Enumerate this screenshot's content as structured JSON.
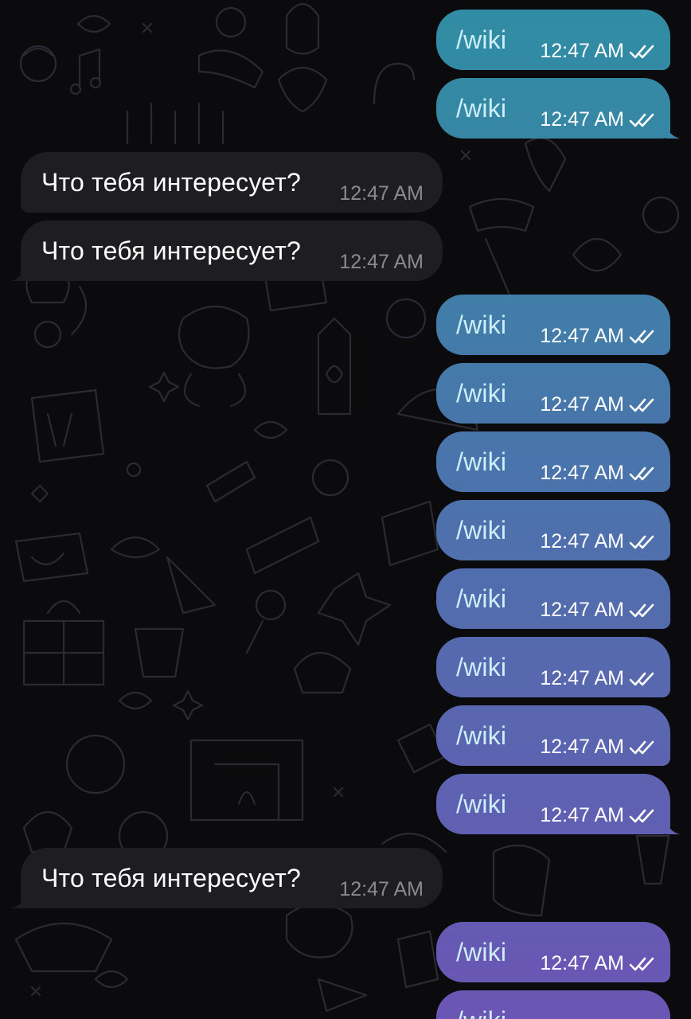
{
  "colors": {
    "background": "#0b0b0d",
    "incoming_bubble": "#1e1e22",
    "outgoing_gradient_top": "#2f8ea3",
    "outgoing_gradient_bottom": "#6b55b5",
    "outgoing_text": "#cdeffa",
    "incoming_time": "#8a8a8f"
  },
  "messages": [
    {
      "direction": "out",
      "text": "/wiki",
      "time": "12:47 AM",
      "status_icon": "double-check-icon"
    },
    {
      "direction": "out",
      "text": "/wiki",
      "time": "12:47 AM",
      "status_icon": "double-check-icon"
    },
    {
      "direction": "in",
      "text": "Что тебя интересует?",
      "time": "12:47 AM"
    },
    {
      "direction": "in",
      "text": "Что тебя интересует?",
      "time": "12:47 AM"
    },
    {
      "direction": "out",
      "text": "/wiki",
      "time": "12:47 AM",
      "status_icon": "double-check-icon"
    },
    {
      "direction": "out",
      "text": "/wiki",
      "time": "12:47 AM",
      "status_icon": "double-check-icon"
    },
    {
      "direction": "out",
      "text": "/wiki",
      "time": "12:47 AM",
      "status_icon": "double-check-icon"
    },
    {
      "direction": "out",
      "text": "/wiki",
      "time": "12:47 AM",
      "status_icon": "double-check-icon"
    },
    {
      "direction": "out",
      "text": "/wiki",
      "time": "12:47 AM",
      "status_icon": "double-check-icon"
    },
    {
      "direction": "out",
      "text": "/wiki",
      "time": "12:47 AM",
      "status_icon": "double-check-icon"
    },
    {
      "direction": "out",
      "text": "/wiki",
      "time": "12:47 AM",
      "status_icon": "double-check-icon"
    },
    {
      "direction": "out",
      "text": "/wiki",
      "time": "12:47 AM",
      "status_icon": "double-check-icon"
    },
    {
      "direction": "in",
      "text": "Что тебя интересует?",
      "time": "12:47 AM"
    },
    {
      "direction": "out",
      "text": "/wiki",
      "time": "12:47 AM",
      "status_icon": "double-check-icon"
    },
    {
      "direction": "out",
      "text": "/wiki",
      "time": "",
      "status_icon": ""
    }
  ]
}
